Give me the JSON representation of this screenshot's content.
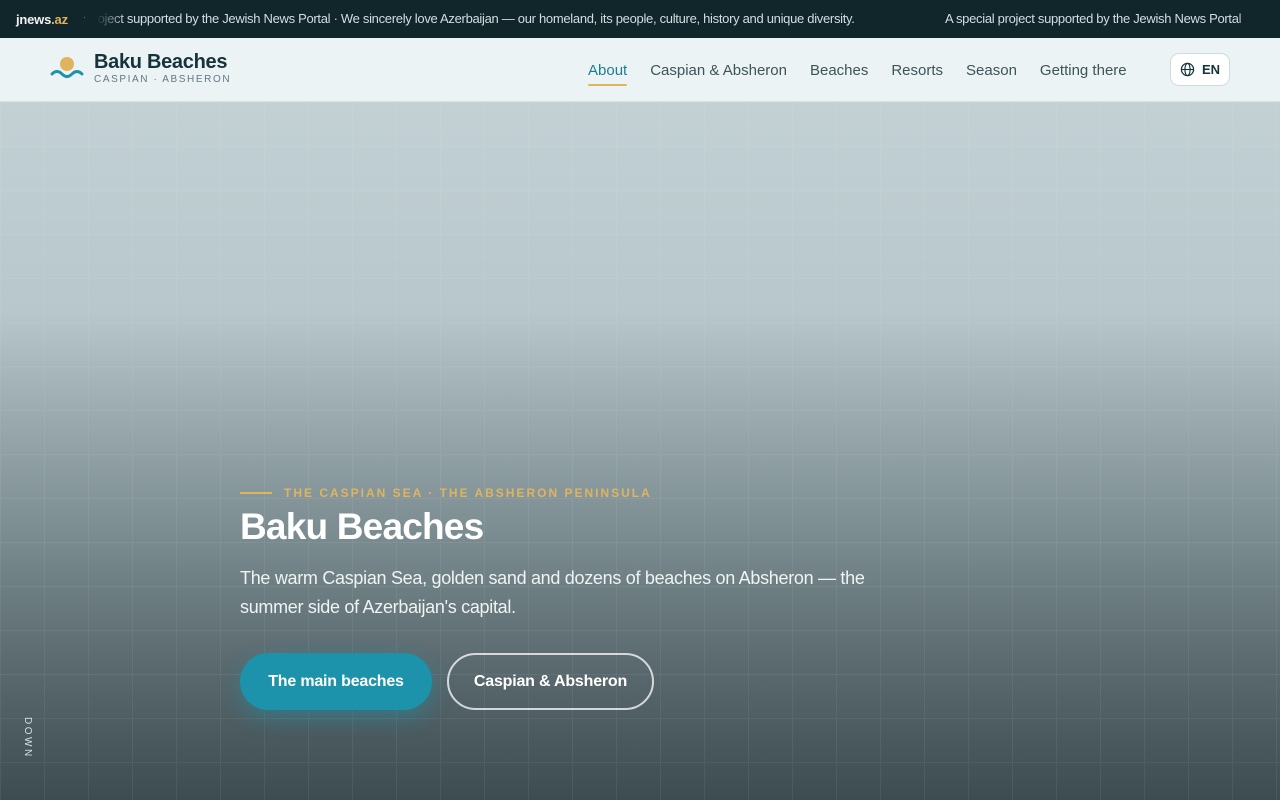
{
  "ticker": {
    "brand_main": "jnews",
    "brand_tld": ".az",
    "separator": "·",
    "message_1": "A special project supported by the Jewish News Portal · We sincerely love Azerbaijan — our homeland, its people, culture, history and unique diversity.",
    "message_2": "A special project supported by the Jewish News Portal"
  },
  "header": {
    "logo_title": "Baku Beaches",
    "logo_subtitle": "CASPIAN · ABSHERON",
    "nav": [
      {
        "label": "About",
        "active": true
      },
      {
        "label": "Caspian & Absheron",
        "active": false
      },
      {
        "label": "Beaches",
        "active": false
      },
      {
        "label": "Resorts",
        "active": false
      },
      {
        "label": "Season",
        "active": false
      },
      {
        "label": "Getting there",
        "active": false
      }
    ],
    "language": "EN"
  },
  "hero": {
    "kicker": "THE CASPIAN SEA · THE ABSHERON PENINSULA",
    "title": "Baku Beaches",
    "text": "The warm Caspian Sea, golden sand and dozens of beaches on Absheron — the summer side of Azerbaijan's capital.",
    "primary_button": "The main beaches",
    "secondary_button": "Caspian & Absheron",
    "scroll_label": "DOWN"
  },
  "colors": {
    "accent": "#1c93aa",
    "gold": "#e0b45e",
    "dark": "#10262b",
    "header_bg": "#ebf3f5"
  },
  "icons": [
    "sun-wave-logo-icon",
    "globe-icon"
  ]
}
